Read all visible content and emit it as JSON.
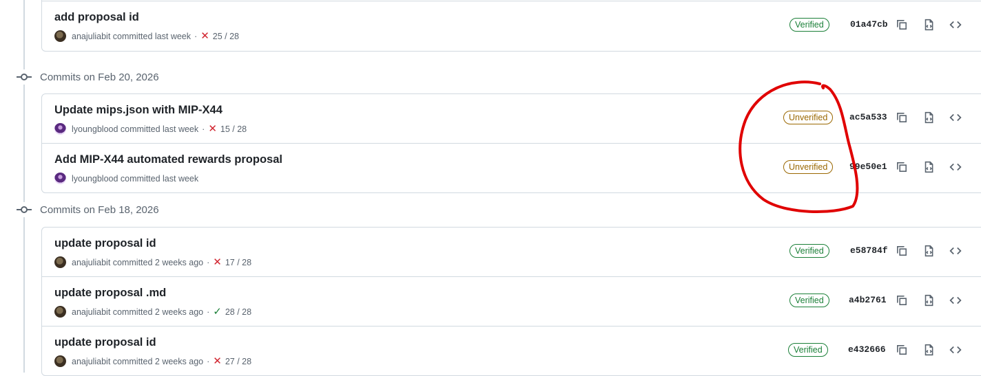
{
  "colors": {
    "verified": "#1a7f37",
    "unverified": "#9a6700",
    "fail": "#d1242f",
    "success": "#1a7f37",
    "annotation": "#e00000"
  },
  "groups": [
    {
      "label": "",
      "commits": [
        {
          "title": "add proposal id",
          "author": "anajuliabit",
          "time": "committed last week",
          "status": "fail",
          "checks": "25 / 28",
          "badge": "Verified",
          "sha": "01a47cb"
        }
      ]
    },
    {
      "label": "Commits on Feb 20, 2026",
      "commits": [
        {
          "title": "Update mips.json with MIP-X44",
          "author": "lyoungblood",
          "time": "committed last week",
          "status": "fail",
          "checks": "15 / 28",
          "badge": "Unverified",
          "sha": "ac5a533"
        },
        {
          "title": "Add MIP-X44 automated rewards proposal",
          "author": "lyoungblood",
          "time": "committed last week",
          "status": "",
          "checks": "",
          "badge": "Unverified",
          "sha": "99e50e1"
        }
      ]
    },
    {
      "label": "Commits on Feb 18, 2026",
      "commits": [
        {
          "title": "update proposal id",
          "author": "anajuliabit",
          "time": "committed 2 weeks ago",
          "status": "fail",
          "checks": "17 / 28",
          "badge": "Verified",
          "sha": "e58784f"
        },
        {
          "title": "update proposal .md",
          "author": "anajuliabit",
          "time": "committed 2 weeks ago",
          "status": "success",
          "checks": "28 / 28",
          "badge": "Verified",
          "sha": "a4b2761"
        },
        {
          "title": "update proposal id",
          "author": "anajuliabit",
          "time": "committed 2 weeks ago",
          "status": "fail",
          "checks": "27 / 28",
          "badge": "Verified",
          "sha": "e432666"
        }
      ]
    }
  ],
  "icons": {
    "copy": "copy-icon",
    "browse": "file-code-icon",
    "code": "code-icon",
    "fail": "x-icon",
    "success": "check-icon"
  }
}
